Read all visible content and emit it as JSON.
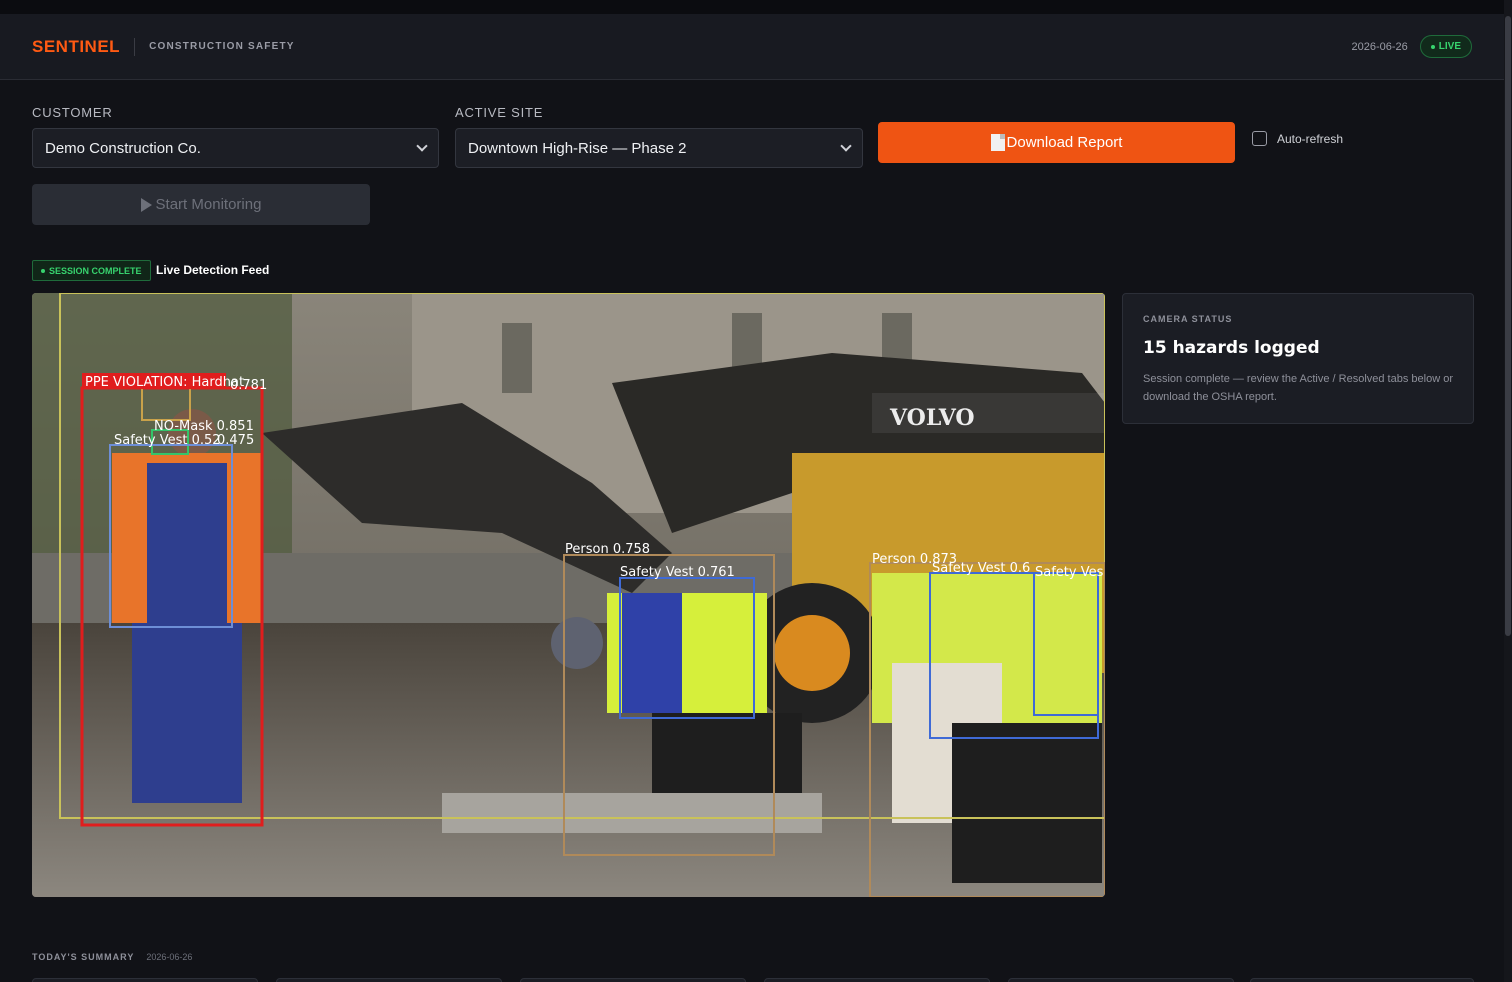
{
  "header": {
    "brand": "SENTINEL",
    "subtitle": "CONSTRUCTION SAFETY",
    "date": "2026-06-26",
    "live_badge": "LIVE"
  },
  "controls": {
    "customer_label": "CUSTOMER",
    "customer_value": "Demo Construction Co.",
    "site_label": "ACTIVE SITE",
    "site_value": "Downtown High-Rise — Phase 2",
    "download_label": "Download Report",
    "autorefresh_label": "Auto-refresh",
    "autorefresh_checked": false,
    "start_label": "Start Monitoring",
    "start_disabled": true
  },
  "feed": {
    "badge": "SESSION COMPLETE",
    "title": "Live Detection Feed",
    "image_text": "VOLVO",
    "detections": [
      {
        "label": "PPE VIOLATION: Hardhat",
        "color": "#e01d1d"
      },
      {
        "label": "NO-Mask 0.851",
        "color": "#ffffff"
      },
      {
        "label": "Safety Vest 0.52",
        "color": "#ffffff"
      },
      {
        "label": "0.475",
        "color": "#ffffff"
      },
      {
        "label": "0.781",
        "color": "#ffffff"
      },
      {
        "label": "Person 0.758",
        "color": "#ffffff"
      },
      {
        "label": "Safety Vest 0.761",
        "color": "#ffffff"
      },
      {
        "label": "Person 0.873",
        "color": "#ffffff"
      },
      {
        "label": "Safety Vest 0.6",
        "color": "#ffffff"
      },
      {
        "label": "Safety Ves",
        "color": "#ffffff"
      }
    ]
  },
  "camera_status": {
    "label": "CAMERA STATUS",
    "title": "15 hazards logged",
    "description": "Session complete — review the Active / Resolved tabs below or download the OSHA report."
  },
  "summary": {
    "label": "TODAY'S SUMMARY",
    "date": "2026-06-26"
  },
  "colors": {
    "accent": "#ef5413",
    "brand": "#ff5a13",
    "success": "#37d36e",
    "violation": "#e01d1d"
  }
}
